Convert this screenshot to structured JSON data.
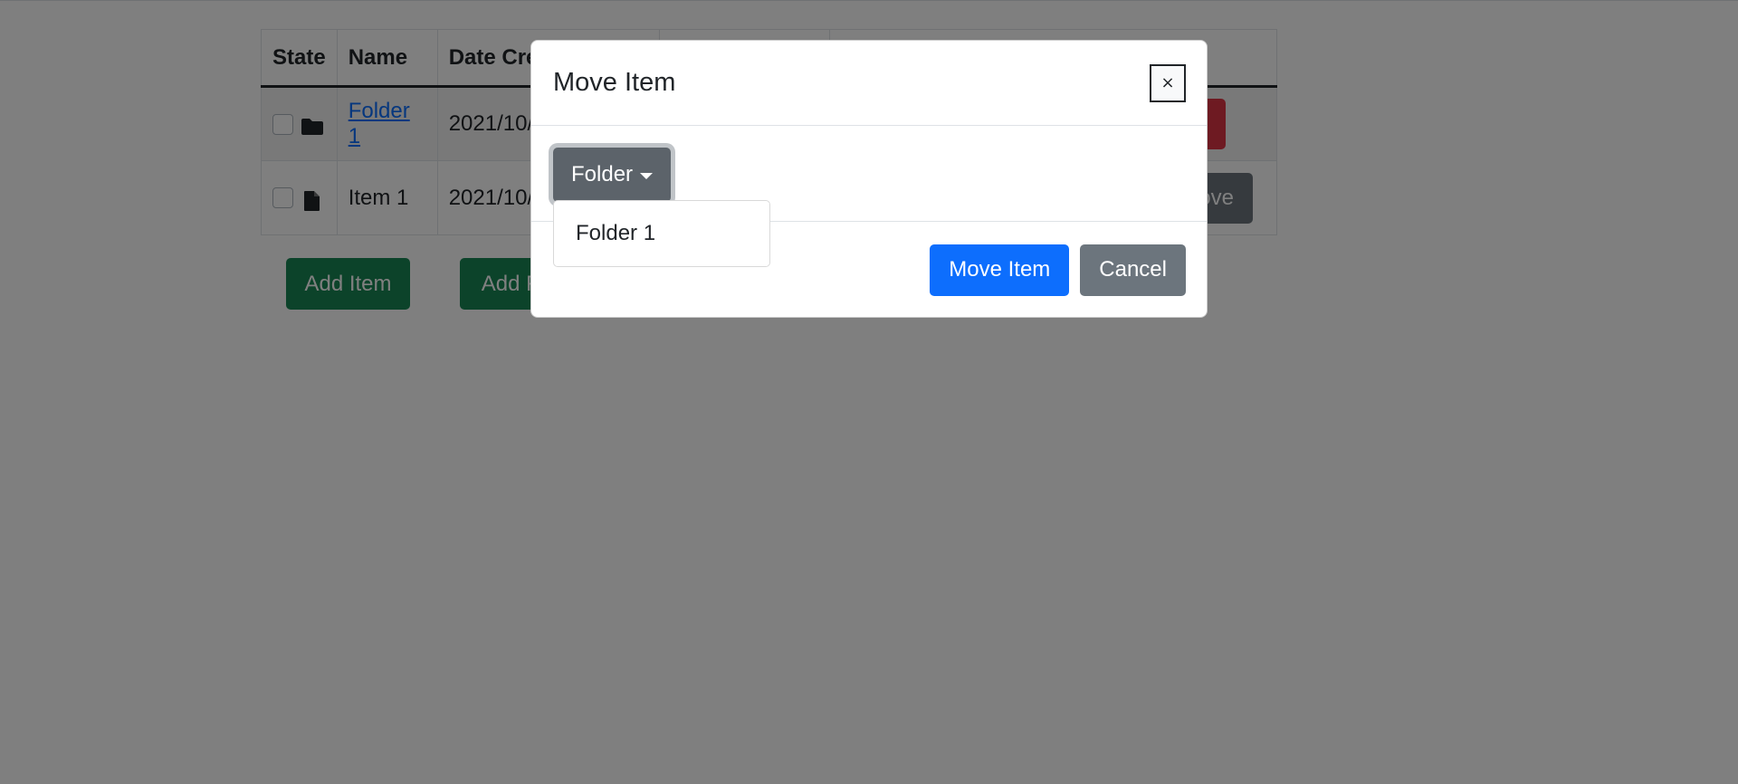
{
  "table": {
    "headers": [
      "State",
      "Name",
      "Date Created",
      "",
      ""
    ],
    "rows": [
      {
        "name": "Folder 1",
        "date": "2021/10/",
        "type_icon": "folder-icon",
        "actions": [
          "",
          ""
        ]
      },
      {
        "name": "Item 1",
        "date": "2021/10/",
        "type_icon": "file-icon",
        "actions": [
          "",
          "Remove"
        ]
      }
    ]
  },
  "buttons": {
    "add_item": "Add Item",
    "add_folder": "Add Folder"
  },
  "modal": {
    "title": "Move Item",
    "close_symbol": "×",
    "dropdown_label": "Folder",
    "dropdown_options": [
      "Folder 1"
    ],
    "primary_button": "Move Item",
    "cancel_button": "Cancel"
  },
  "colors": {
    "primary": "#0d6efd",
    "secondary": "#6c757d",
    "success": "#198754",
    "danger": "#dc3545",
    "overlay": "rgba(0,0,0,0.5)"
  }
}
